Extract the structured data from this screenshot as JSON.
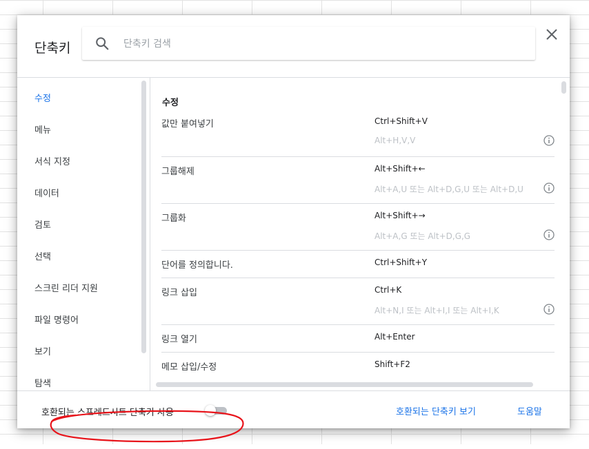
{
  "dialog": {
    "title": "단축키",
    "search_placeholder": "단축키 검색",
    "close_icon": "close-icon"
  },
  "sidebar": {
    "items": [
      {
        "label": "수정",
        "active": true
      },
      {
        "label": "메뉴"
      },
      {
        "label": "서식 지정"
      },
      {
        "label": "데이터"
      },
      {
        "label": "검토"
      },
      {
        "label": "선택"
      },
      {
        "label": "스크린 리더 지원"
      },
      {
        "label": "파일 명령어"
      },
      {
        "label": "보기"
      },
      {
        "label": "탐색"
      }
    ]
  },
  "content": {
    "section_title": "수정",
    "rows": [
      {
        "label": "값만 붙여넣기",
        "key": "Ctrl+Shift+V",
        "alt": "Alt+H,V,V"
      },
      {
        "label": "그룹해제",
        "key": "Alt+Shift+←",
        "alt": "Alt+A,U 또는 Alt+D,G,U 또는 Alt+D,U"
      },
      {
        "label": "그룹화",
        "key": "Alt+Shift+→",
        "alt": "Alt+A,G 또는 Alt+D,G,G"
      },
      {
        "label": "단어를 정의합니다.",
        "key": "Ctrl+Shift+Y"
      },
      {
        "label": "링크 삽입",
        "key": "Ctrl+K",
        "alt": "Alt+N,I 또는 Alt+I,I 또는 Alt+I,K"
      },
      {
        "label": "링크 열기",
        "key": "Alt+Enter"
      },
      {
        "label": "메모 삽입/수정",
        "key": "Shift+F2"
      }
    ]
  },
  "footer": {
    "toggle_label": "호환되는 스프레드시트 단축키 사용",
    "toggle_on": false,
    "view_compatible_link": "호환되는 단축키 보기",
    "help_link": "도움말"
  },
  "colors": {
    "accent": "#1a73e8",
    "annotation": "#e8141b"
  }
}
